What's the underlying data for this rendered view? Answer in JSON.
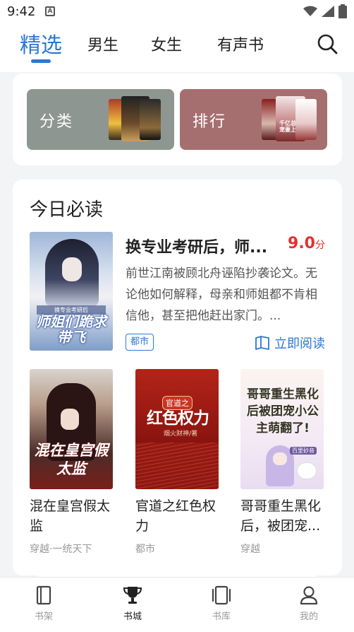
{
  "status_bar": {
    "time": "9:42",
    "note_icon": "A"
  },
  "top_tabs": [
    {
      "label": "精选",
      "active": true
    },
    {
      "label": "男生",
      "active": false
    },
    {
      "label": "女生",
      "active": false
    },
    {
      "label": "有声书",
      "active": false
    }
  ],
  "banners": {
    "category": "分类",
    "ranking": "排行",
    "ranking_cover_text": "千亿总裁 宠妻上瘾"
  },
  "today": {
    "section_title": "今日必读",
    "feature": {
      "title": "换专业考研后，师...",
      "score": "9.0",
      "score_unit": "分",
      "description": "前世江南被顾北舟诬陷抄袭论文。无论他如何解释，母亲和师姐都不肯相信他，甚至把他赶出家门。...",
      "tag": "都市",
      "read_label": "立即阅读",
      "cover_subtitle": "换专业考研后",
      "cover_title": "师姐们跪求带飞"
    },
    "books": [
      {
        "title": "混在皇宫假太监",
        "genre": "穿越·一统天下",
        "cover_title": "混在皇宫假太监"
      },
      {
        "title": "官道之红色权力",
        "genre": "都市",
        "cover_badge": "官道之",
        "cover_title": "红色权力",
        "cover_author": "烟火财神/著"
      },
      {
        "title": "哥哥重生黑化后，被团宠...",
        "genre": "穿越",
        "cover_title": "哥哥重生黑化后被团宠小公主萌翻了!",
        "cover_author": "百里砂音"
      }
    ]
  },
  "bottom_nav": [
    {
      "label": "书架",
      "icon": "bookshelf-icon",
      "active": false
    },
    {
      "label": "书城",
      "icon": "trophy-icon",
      "active": true
    },
    {
      "label": "书库",
      "icon": "library-icon",
      "active": false
    },
    {
      "label": "我的",
      "icon": "profile-icon",
      "active": false
    }
  ],
  "colors": {
    "accent": "#2a78d4",
    "score": "#e2312f"
  }
}
